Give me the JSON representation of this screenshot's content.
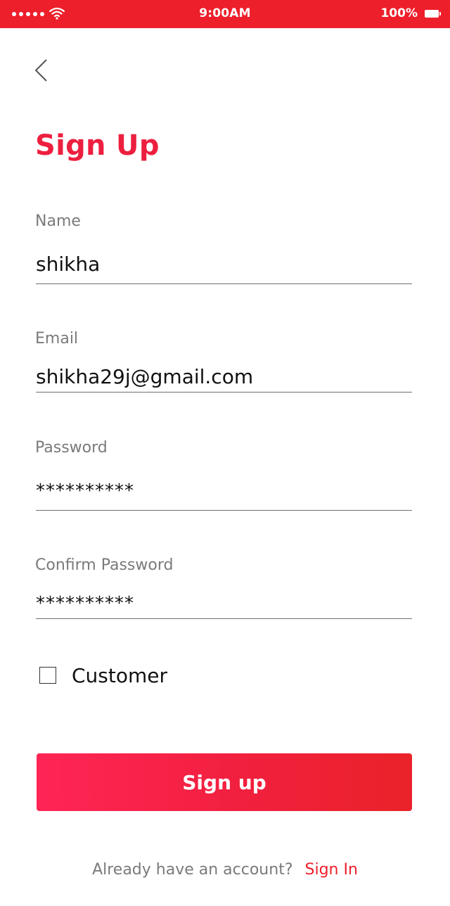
{
  "status_bar": {
    "time": "9:00AM",
    "battery": "100%"
  },
  "page": {
    "title": "Sign Up"
  },
  "form": {
    "name": {
      "label": "Name",
      "value": "shikha"
    },
    "email": {
      "label": "Email",
      "value": "shikha29j@gmail.com"
    },
    "password": {
      "label": "Password",
      "value": "**********"
    },
    "confirm_password": {
      "label": "Confirm Password",
      "value": "**********"
    },
    "customer_checkbox": {
      "label": "Customer",
      "checked": false
    }
  },
  "actions": {
    "signup_label": "Sign up"
  },
  "footer": {
    "prompt": "Already have an account?",
    "signin_label": "Sign In"
  },
  "colors": {
    "accent": "#ed1f2b",
    "title": "#ed1f3f",
    "label": "#7a7a7a"
  },
  "icons": {
    "back": "chevron-left-icon",
    "signal": "signal-dots-icon",
    "wifi": "wifi-icon",
    "battery": "battery-icon"
  }
}
